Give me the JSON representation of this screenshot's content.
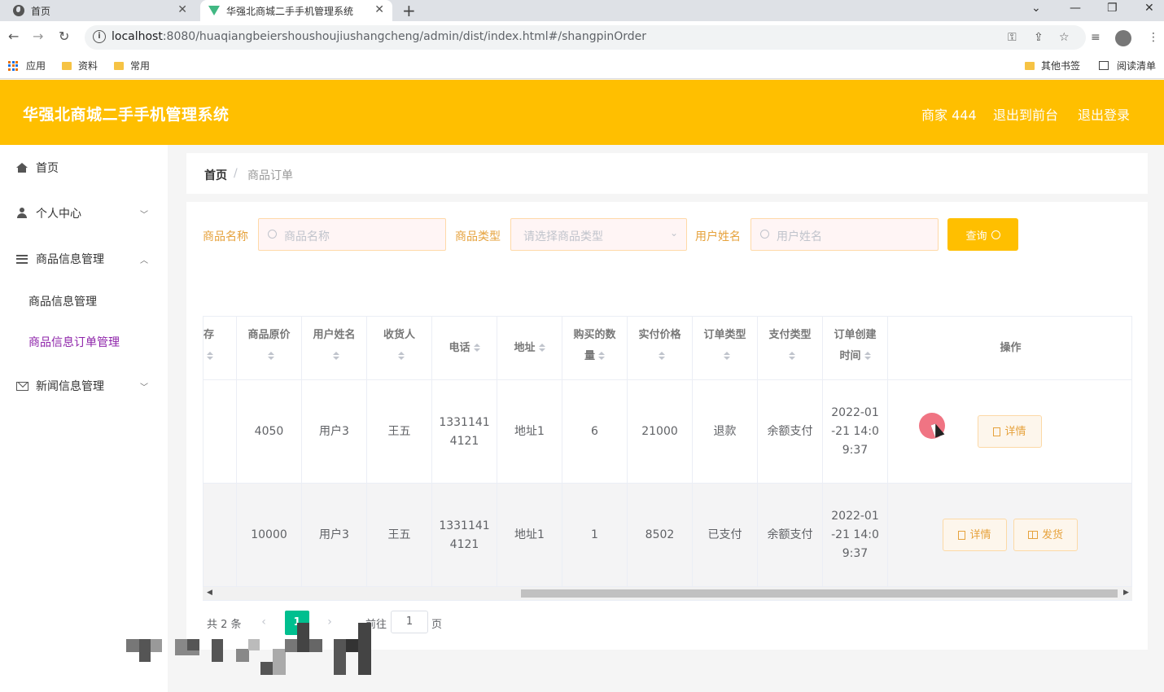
{
  "browser": {
    "tabs": [
      {
        "title": "首页"
      },
      {
        "title": "华强北商城二手手机管理系统"
      }
    ],
    "url_host": "localhost",
    "url_path": ":8080/huaqiangbeiershoushoujiushangcheng/admin/dist/index.html#/shangpinOrder",
    "bookmarks": {
      "apps": "应用",
      "folder1": "资料",
      "folder2": "常用",
      "other": "其他书签",
      "reading": "阅读清单"
    }
  },
  "header": {
    "title": "华强北商城二手手机管理系统",
    "user": "商家 444",
    "to_front": "退出到前台",
    "logout": "退出登录",
    "accent_color": "#ffbf00"
  },
  "sidebar": {
    "items": [
      {
        "label": "首页",
        "icon": "home-icon"
      },
      {
        "label": "个人中心",
        "icon": "user-icon"
      },
      {
        "label": "商品信息管理",
        "icon": "list-icon"
      },
      {
        "label": "新闻信息管理",
        "icon": "mail-icon"
      }
    ],
    "sub_items": [
      {
        "label": "商品信息管理"
      },
      {
        "label": "商品信息订单管理",
        "active": true
      }
    ]
  },
  "breadcrumb": {
    "home": "首页",
    "separator": "/",
    "current": "商品订单"
  },
  "search": {
    "name_label": "商品名称",
    "name_placeholder": "商品名称",
    "type_label": "商品类型",
    "type_placeholder": "请选择商品类型",
    "user_label": "用户姓名",
    "user_placeholder": "用户姓名",
    "query_button": "查询"
  },
  "table": {
    "columns": [
      {
        "line1": "库存",
        "line2": ""
      },
      {
        "line1": "商品原价",
        "line2": ""
      },
      {
        "line1": "用户姓名",
        "line2": ""
      },
      {
        "line1": "收货人",
        "line2": ""
      },
      {
        "line1": "电话",
        "line2": ""
      },
      {
        "line1": "地址",
        "line2": ""
      },
      {
        "line1": "购买的数",
        "line2": "量"
      },
      {
        "line1": "实付价格",
        "line2": ""
      },
      {
        "line1": "订单类型",
        "line2": ""
      },
      {
        "line1": "支付类型",
        "line2": ""
      },
      {
        "line1": "订单创建",
        "line2": "时间"
      },
      {
        "line1": "操作",
        "line2": ""
      }
    ],
    "rows": [
      {
        "stock": "",
        "original_price": "4050",
        "user_name": "用户3",
        "receiver": "王五",
        "phone_1": "1331141",
        "phone_2": "4121",
        "address": "地址1",
        "quantity": "6",
        "paid_price": "21000",
        "order_type": "退款",
        "pay_type": "余额支付",
        "created_1": "2022-01",
        "created_2": "-21 14:0",
        "created_3": "9:37",
        "actions": [
          "详情"
        ]
      },
      {
        "stock": "",
        "original_price": "10000",
        "user_name": "用户3",
        "receiver": "王五",
        "phone_1": "1331141",
        "phone_2": "4121",
        "address": "地址1",
        "quantity": "1",
        "paid_price": "8502",
        "order_type": "已支付",
        "pay_type": "余额支付",
        "created_1": "2022-01",
        "created_2": "-21 14:0",
        "created_3": "9:37",
        "actions": [
          "详情",
          "发货"
        ]
      }
    ]
  },
  "pagination": {
    "total": "共 2 条",
    "prev": "‹",
    "next": "›",
    "current_page": "1",
    "goto_label": "前往",
    "goto_value": "1",
    "unit": "页"
  }
}
